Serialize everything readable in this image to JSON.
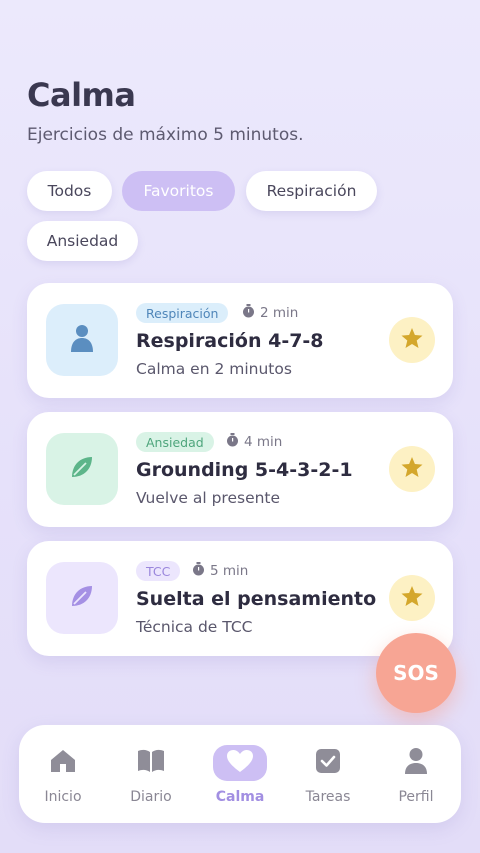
{
  "header": {
    "title": "Calma",
    "subtitle": "Ejercicios de máximo 5 minutos."
  },
  "filters": [
    {
      "label": "Todos",
      "active": false
    },
    {
      "label": "Favoritos",
      "active": true
    },
    {
      "label": "Respiración",
      "active": false
    },
    {
      "label": "Ansiedad",
      "active": false
    }
  ],
  "exercises": [
    {
      "tag": "Respiración",
      "duration": "2 min",
      "title": "Respiración 4-7-8",
      "description": "Calma en 2 minutos",
      "icon": "person-icon",
      "favorite": true
    },
    {
      "tag": "Ansiedad",
      "duration": "4 min",
      "title": "Grounding 5-4-3-2-1",
      "description": "Vuelve al presente",
      "icon": "leaf-icon",
      "favorite": true
    },
    {
      "tag": "TCC",
      "duration": "5 min",
      "title": "Suelta el pensamiento",
      "description": "Técnica de TCC",
      "icon": "feather-icon",
      "favorite": true
    }
  ],
  "sos": {
    "label": "SOS",
    "color": "#f7a594"
  },
  "nav": [
    {
      "label": "Inicio",
      "icon": "home-icon",
      "active": false
    },
    {
      "label": "Diario",
      "icon": "book-icon",
      "active": false
    },
    {
      "label": "Calma",
      "icon": "heart-icon",
      "active": true
    },
    {
      "label": "Tareas",
      "icon": "checkbox-icon",
      "active": false
    },
    {
      "label": "Perfil",
      "icon": "person-icon",
      "active": false
    }
  ],
  "colors": {
    "accent": "#cdbff4",
    "accent_text": "#a28fe2",
    "star": "#d4a72c",
    "tag_respiracion_bg": "#dbeefb",
    "tag_ansiedad_bg": "#d9f3e6",
    "tag_tcc_bg": "#ece6fd"
  }
}
